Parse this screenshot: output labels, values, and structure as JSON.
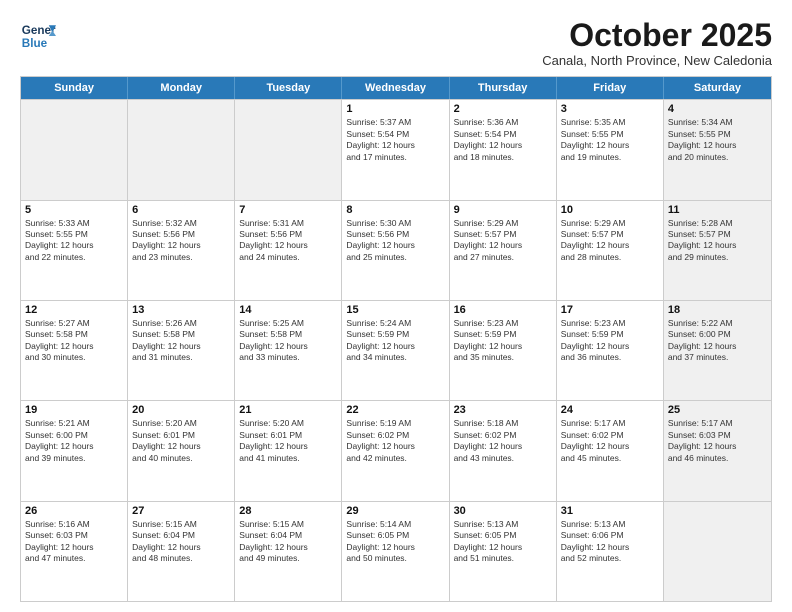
{
  "header": {
    "logo_line1": "General",
    "logo_line2": "Blue",
    "month": "October 2025",
    "location": "Canala, North Province, New Caledonia"
  },
  "weekdays": [
    "Sunday",
    "Monday",
    "Tuesday",
    "Wednesday",
    "Thursday",
    "Friday",
    "Saturday"
  ],
  "rows": [
    [
      {
        "day": "",
        "info": "",
        "shaded": true
      },
      {
        "day": "",
        "info": "",
        "shaded": true
      },
      {
        "day": "",
        "info": "",
        "shaded": true
      },
      {
        "day": "1",
        "info": "Sunrise: 5:37 AM\nSunset: 5:54 PM\nDaylight: 12 hours\nand 17 minutes."
      },
      {
        "day": "2",
        "info": "Sunrise: 5:36 AM\nSunset: 5:54 PM\nDaylight: 12 hours\nand 18 minutes."
      },
      {
        "day": "3",
        "info": "Sunrise: 5:35 AM\nSunset: 5:55 PM\nDaylight: 12 hours\nand 19 minutes."
      },
      {
        "day": "4",
        "info": "Sunrise: 5:34 AM\nSunset: 5:55 PM\nDaylight: 12 hours\nand 20 minutes.",
        "shaded": true
      }
    ],
    [
      {
        "day": "5",
        "info": "Sunrise: 5:33 AM\nSunset: 5:55 PM\nDaylight: 12 hours\nand 22 minutes."
      },
      {
        "day": "6",
        "info": "Sunrise: 5:32 AM\nSunset: 5:56 PM\nDaylight: 12 hours\nand 23 minutes."
      },
      {
        "day": "7",
        "info": "Sunrise: 5:31 AM\nSunset: 5:56 PM\nDaylight: 12 hours\nand 24 minutes."
      },
      {
        "day": "8",
        "info": "Sunrise: 5:30 AM\nSunset: 5:56 PM\nDaylight: 12 hours\nand 25 minutes."
      },
      {
        "day": "9",
        "info": "Sunrise: 5:29 AM\nSunset: 5:57 PM\nDaylight: 12 hours\nand 27 minutes."
      },
      {
        "day": "10",
        "info": "Sunrise: 5:29 AM\nSunset: 5:57 PM\nDaylight: 12 hours\nand 28 minutes."
      },
      {
        "day": "11",
        "info": "Sunrise: 5:28 AM\nSunset: 5:57 PM\nDaylight: 12 hours\nand 29 minutes.",
        "shaded": true
      }
    ],
    [
      {
        "day": "12",
        "info": "Sunrise: 5:27 AM\nSunset: 5:58 PM\nDaylight: 12 hours\nand 30 minutes."
      },
      {
        "day": "13",
        "info": "Sunrise: 5:26 AM\nSunset: 5:58 PM\nDaylight: 12 hours\nand 31 minutes."
      },
      {
        "day": "14",
        "info": "Sunrise: 5:25 AM\nSunset: 5:58 PM\nDaylight: 12 hours\nand 33 minutes."
      },
      {
        "day": "15",
        "info": "Sunrise: 5:24 AM\nSunset: 5:59 PM\nDaylight: 12 hours\nand 34 minutes."
      },
      {
        "day": "16",
        "info": "Sunrise: 5:23 AM\nSunset: 5:59 PM\nDaylight: 12 hours\nand 35 minutes."
      },
      {
        "day": "17",
        "info": "Sunrise: 5:23 AM\nSunset: 5:59 PM\nDaylight: 12 hours\nand 36 minutes."
      },
      {
        "day": "18",
        "info": "Sunrise: 5:22 AM\nSunset: 6:00 PM\nDaylight: 12 hours\nand 37 minutes.",
        "shaded": true
      }
    ],
    [
      {
        "day": "19",
        "info": "Sunrise: 5:21 AM\nSunset: 6:00 PM\nDaylight: 12 hours\nand 39 minutes."
      },
      {
        "day": "20",
        "info": "Sunrise: 5:20 AM\nSunset: 6:01 PM\nDaylight: 12 hours\nand 40 minutes."
      },
      {
        "day": "21",
        "info": "Sunrise: 5:20 AM\nSunset: 6:01 PM\nDaylight: 12 hours\nand 41 minutes."
      },
      {
        "day": "22",
        "info": "Sunrise: 5:19 AM\nSunset: 6:02 PM\nDaylight: 12 hours\nand 42 minutes."
      },
      {
        "day": "23",
        "info": "Sunrise: 5:18 AM\nSunset: 6:02 PM\nDaylight: 12 hours\nand 43 minutes."
      },
      {
        "day": "24",
        "info": "Sunrise: 5:17 AM\nSunset: 6:02 PM\nDaylight: 12 hours\nand 45 minutes."
      },
      {
        "day": "25",
        "info": "Sunrise: 5:17 AM\nSunset: 6:03 PM\nDaylight: 12 hours\nand 46 minutes.",
        "shaded": true
      }
    ],
    [
      {
        "day": "26",
        "info": "Sunrise: 5:16 AM\nSunset: 6:03 PM\nDaylight: 12 hours\nand 47 minutes."
      },
      {
        "day": "27",
        "info": "Sunrise: 5:15 AM\nSunset: 6:04 PM\nDaylight: 12 hours\nand 48 minutes."
      },
      {
        "day": "28",
        "info": "Sunrise: 5:15 AM\nSunset: 6:04 PM\nDaylight: 12 hours\nand 49 minutes."
      },
      {
        "day": "29",
        "info": "Sunrise: 5:14 AM\nSunset: 6:05 PM\nDaylight: 12 hours\nand 50 minutes."
      },
      {
        "day": "30",
        "info": "Sunrise: 5:13 AM\nSunset: 6:05 PM\nDaylight: 12 hours\nand 51 minutes."
      },
      {
        "day": "31",
        "info": "Sunrise: 5:13 AM\nSunset: 6:06 PM\nDaylight: 12 hours\nand 52 minutes."
      },
      {
        "day": "",
        "info": "",
        "shaded": true
      }
    ]
  ]
}
